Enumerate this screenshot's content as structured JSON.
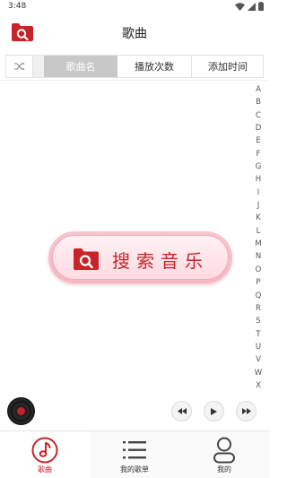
{
  "status_bar": {
    "time": "3:48",
    "icons": [
      "wifi-icon",
      "signal-icon",
      "battery-icon"
    ]
  },
  "header": {
    "title": "歌曲",
    "logo_icon": "music-search-logo-icon"
  },
  "sort_bar": {
    "shuffle_icon": "shuffle-icon",
    "tabs": [
      {
        "label": "歌曲名",
        "active": true
      },
      {
        "label": "播放次数",
        "active": false
      },
      {
        "label": "添加时间",
        "active": false
      }
    ]
  },
  "alphabet_index": [
    "A",
    "B",
    "C",
    "D",
    "E",
    "F",
    "G",
    "H",
    "I",
    "J",
    "K",
    "L",
    "M",
    "N",
    "O",
    "P",
    "Q",
    "R",
    "S",
    "T",
    "U",
    "V",
    "W",
    "X"
  ],
  "search_button": {
    "label": "搜索音乐",
    "icon": "music-search-icon"
  },
  "player": {
    "disc_icon": "vinyl-disc-icon",
    "controls": [
      "previous-icon",
      "play-icon",
      "next-icon"
    ]
  },
  "bottom_nav": [
    {
      "label": "歌曲",
      "icon": "music-note-icon",
      "active": true
    },
    {
      "label": "我的歌单",
      "icon": "playlist-icon",
      "active": false
    },
    {
      "label": "我的",
      "icon": "user-icon",
      "active": false
    }
  ],
  "colors": {
    "brand_red": "#c8232b",
    "pill_pink": "#f6b7c2",
    "active_tab_gray": "#c8c8c8"
  }
}
